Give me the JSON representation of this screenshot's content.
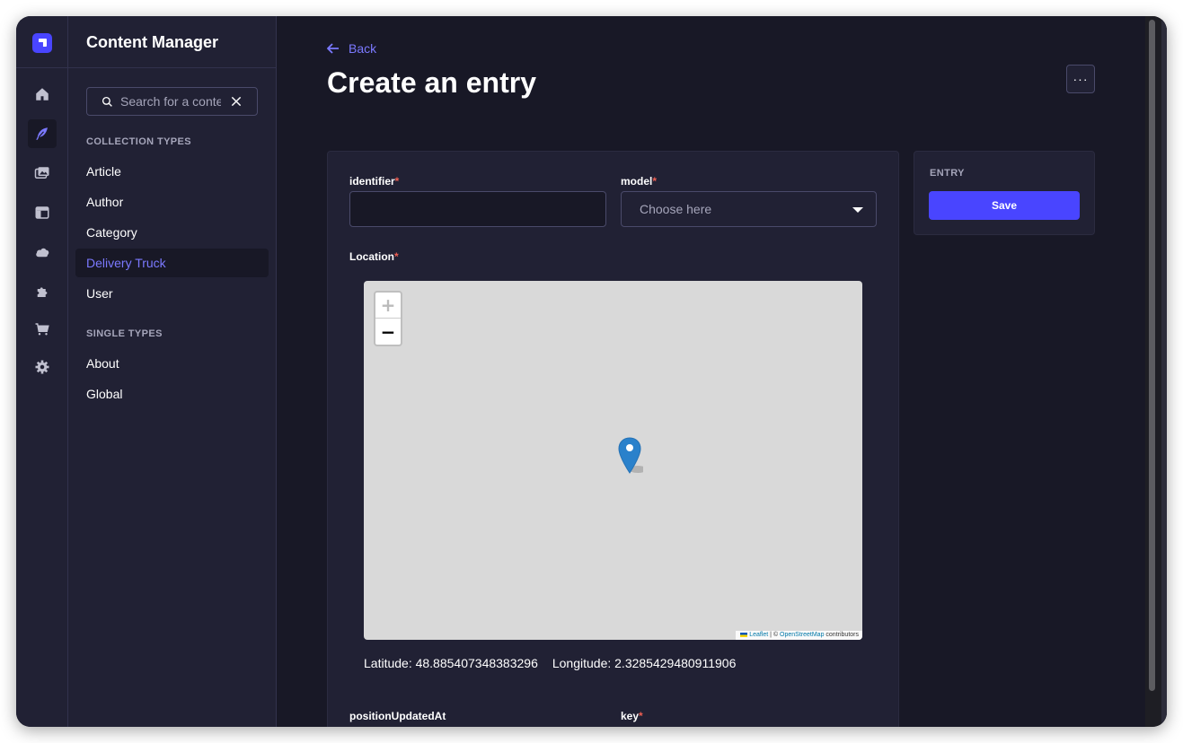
{
  "sidebar": {
    "rail_items": [
      {
        "icon": "home-icon"
      },
      {
        "icon": "content-manager-feather-icon",
        "active": true
      },
      {
        "icon": "media-library-icon"
      },
      {
        "icon": "content-type-builder-icon"
      },
      {
        "icon": "cloud-icon"
      },
      {
        "icon": "plugins-puzzle-icon"
      },
      {
        "icon": "marketplace-cart-icon"
      },
      {
        "icon": "settings-gear-icon"
      }
    ]
  },
  "subnav": {
    "title": "Content Manager",
    "search_placeholder": "Search for a content type",
    "collection_label": "COLLECTION TYPES",
    "collection_items": [
      "Article",
      "Author",
      "Category",
      "Delivery Truck",
      "User"
    ],
    "active_item": "Delivery Truck",
    "single_label": "SINGLE TYPES",
    "single_items": [
      "About",
      "Global"
    ]
  },
  "header": {
    "back_label": "Back",
    "title": "Create an entry",
    "more_label": "···"
  },
  "form": {
    "identifier": {
      "label": "identifier",
      "required": "*",
      "value": ""
    },
    "model": {
      "label": "model",
      "required": "*",
      "placeholder": "Choose here"
    },
    "location": {
      "label": "Location",
      "required": "*",
      "zoom_in": "+",
      "zoom_out": "−",
      "attribution_leaflet": "Leaflet",
      "attribution_sep": " | © ",
      "attribution_osm": "OpenStreetMap",
      "attribution_rest": " contributors",
      "latitude_text": "Latitude: 48.885407348383296",
      "longitude_text": "Longitude: 2.3285429480911906"
    },
    "position_updated_at": {
      "label": "positionUpdatedAt"
    },
    "key": {
      "label": "key",
      "required": "*"
    }
  },
  "side": {
    "label": "ENTRY",
    "save_label": "Save"
  },
  "colors": {
    "accent": "#4945ff",
    "accent_text": "#7b79ff",
    "required": "#ee5e52",
    "marker": "#2a81cb"
  }
}
